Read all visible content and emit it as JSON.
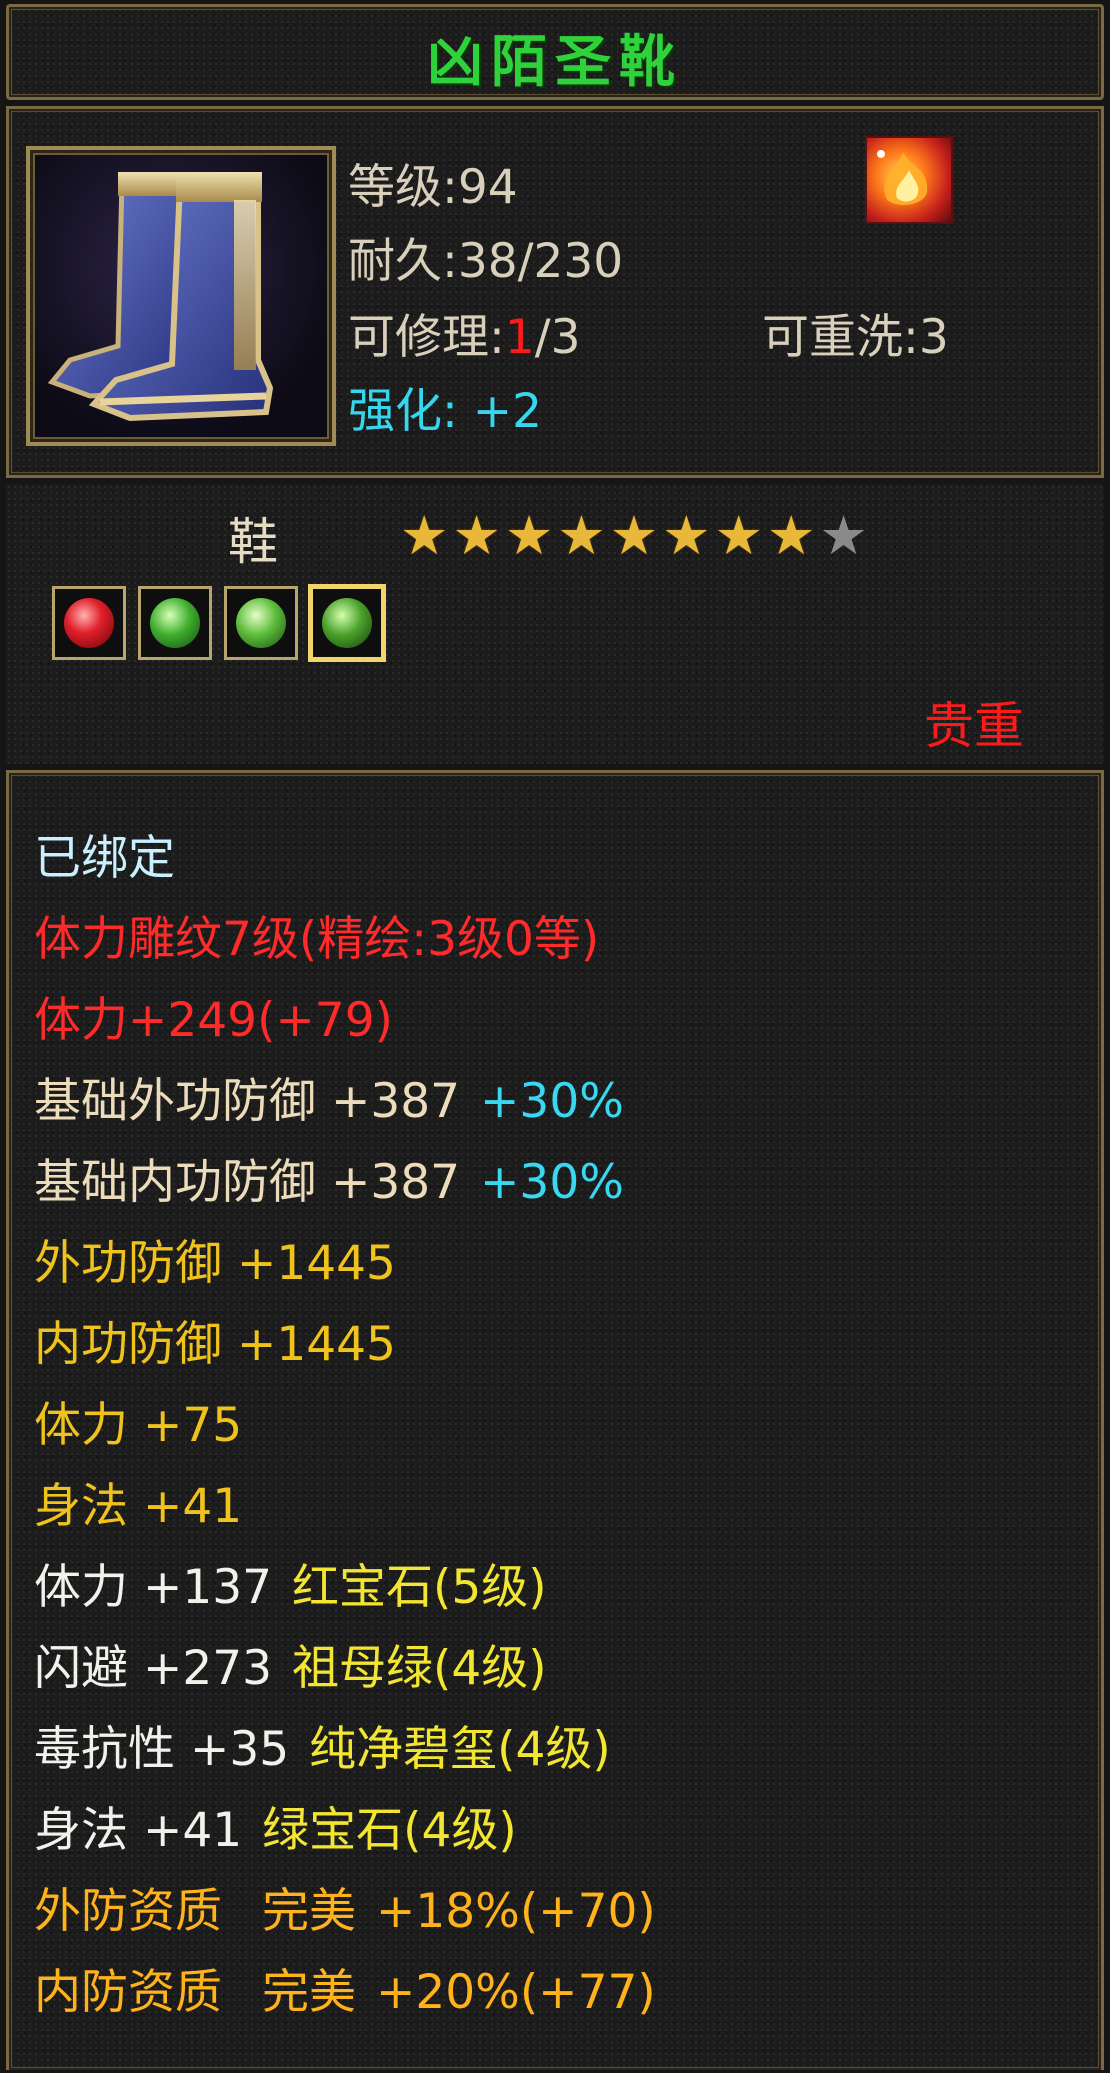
{
  "item": {
    "name": "凶陌圣靴",
    "level_label": "等级:94",
    "durability_label": "耐久:38/230",
    "repair_prefix": "可修理:",
    "repair_current": "1",
    "repair_max": "/3",
    "rewash_label": "可重洗:3",
    "enhance_label": "强化: +2",
    "slot": "鞋",
    "stars": {
      "filled": 8,
      "total": 9
    },
    "quality": "贵重",
    "gems": [
      "ruby",
      "emerald",
      "jade",
      "green"
    ]
  },
  "attributes": {
    "bound": "已绑定",
    "engrave": "体力雕纹7级(精绘:3级0等)",
    "stamina_total": "体力+249(+79)",
    "base_outer_def": {
      "label": "基础外功防御 +387",
      "bonus": "+30%"
    },
    "base_inner_def": {
      "label": "基础内功防御 +387",
      "bonus": "+30%"
    },
    "outer_def": "外功防御 +1445",
    "inner_def": "内功防御 +1445",
    "stamina": "体力 +75",
    "agility": "身法 +41",
    "gem_lines": [
      {
        "stat": "体力 +137",
        "gem": "红宝石(5级)"
      },
      {
        "stat": "闪避 +273",
        "gem": "祖母绿(4级)"
      },
      {
        "stat": "毒抗性 +35",
        "gem": "纯净碧玺(4级)"
      },
      {
        "stat": "身法 +41",
        "gem": "绿宝石(4级)"
      }
    ],
    "outer_quality": {
      "label": "外防资质",
      "grade": "完美",
      "value": "+18%(+70)"
    },
    "inner_quality": {
      "label": "内防资质",
      "grade": "完美",
      "value": "+20%(+77)"
    }
  },
  "colors": {
    "title_green": "#2fd23a",
    "red": "#ff2a2a",
    "cyan": "#38d8f0",
    "gold": "#f0c21c",
    "orange": "#ffb21a"
  }
}
